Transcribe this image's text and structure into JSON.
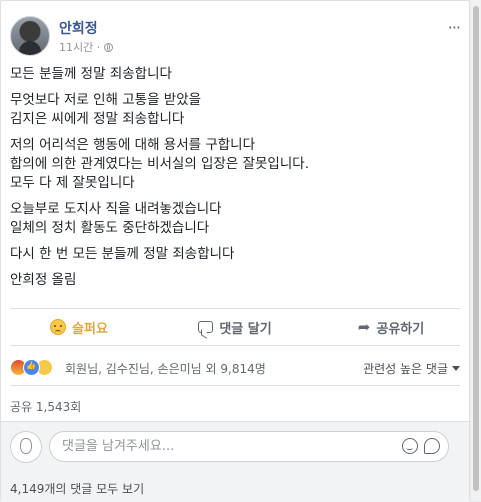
{
  "post": {
    "author": "안희정",
    "time": "11시간 ·",
    "more": "···",
    "paragraphs": [
      [
        "모든 분들께 정말 죄송합니다"
      ],
      [
        "무엇보다 저로 인해 고통을 받았을",
        "김지은 씨에게 정말 죄송합니다"
      ],
      [
        "저의 어리석은 행동에 대해 용서를 구합니다",
        "합의에 의한 관계였다는 비서실의 입장은 잘못입니다.",
        "모두 다 제 잘못입니다"
      ],
      [
        "오늘부로 도지사 직을 내려놓겠습니다",
        "일체의 정치 활동도 중단하겠습니다"
      ],
      [
        "다시 한 번 모든 분들께 정말 죄송합니다"
      ],
      [
        "안희정 올림"
      ]
    ]
  },
  "actions": {
    "reaction_label": "슬퍼요",
    "comment_label": "댓글 달기",
    "share_label": "공유하기"
  },
  "reactions": {
    "names": "회원님, 김수진님, 손은미님 외 9,814명",
    "sort": "관련성 높은 댓글"
  },
  "shares": "공유 1,543회",
  "comment_box": {
    "placeholder": "댓글을 남겨주세요...",
    "view_all": "4,149개의 댓글 모두 보기"
  },
  "colors": {
    "link": "#365899",
    "sad_reaction": "#e6a73a"
  }
}
